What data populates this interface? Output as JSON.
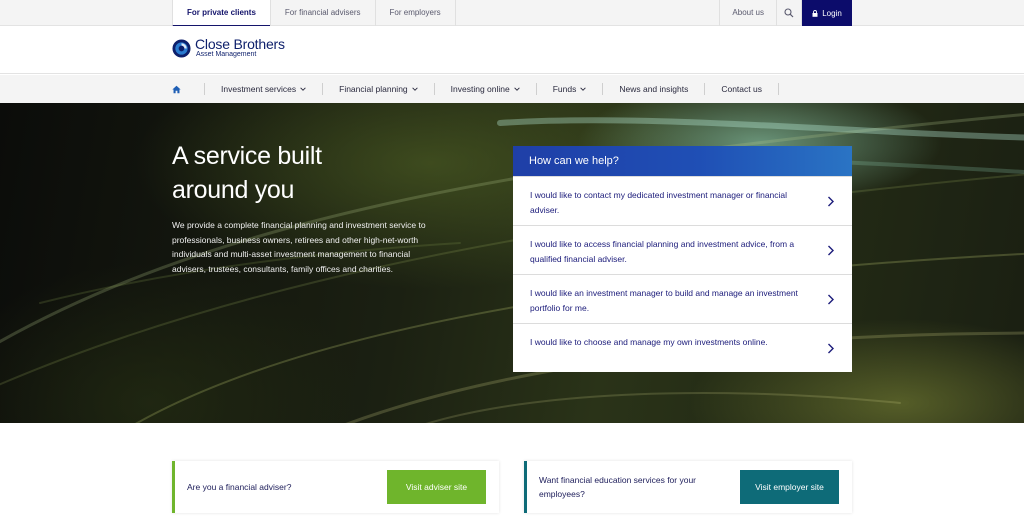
{
  "audience_tabs": [
    {
      "label": "For private clients",
      "active": true
    },
    {
      "label": "For financial advisers",
      "active": false
    },
    {
      "label": "For employers",
      "active": false
    }
  ],
  "topbar": {
    "about_label": "About us",
    "search_icon": "search-icon",
    "login_label": "Login",
    "login_icon": "lock-icon"
  },
  "logo": {
    "name": "Close Brothers",
    "subtitle": "Asset Management"
  },
  "nav": {
    "home_icon": "home-icon",
    "items": [
      {
        "label": "Investment services",
        "has_dropdown": true
      },
      {
        "label": "Financial planning",
        "has_dropdown": true
      },
      {
        "label": "Investing online",
        "has_dropdown": true
      },
      {
        "label": "Funds",
        "has_dropdown": true
      },
      {
        "label": "News and insights",
        "has_dropdown": false
      },
      {
        "label": "Contact us",
        "has_dropdown": false
      }
    ]
  },
  "hero": {
    "title_line1": "A service built",
    "title_line2": "around you",
    "body": "We provide a complete financial planning and investment service to professionals, business owners, retirees and other high-net-worth individuals and multi-asset investment management to financial advisers, trustees, consultants, family offices and charities."
  },
  "help": {
    "heading": "How can we help?",
    "items": [
      "I would like to contact my dedicated investment manager or financial adviser.",
      "I would like to access financial planning and investment advice, from a qualified financial adviser.",
      "I would like an investment manager to build and manage an investment portfolio for me.",
      "I would like to choose and manage my own investments online."
    ]
  },
  "cards": {
    "adviser": {
      "text": "Are you a financial adviser?",
      "button": "Visit adviser site"
    },
    "employer": {
      "text": "Want financial education services for your employees?",
      "button": "Visit employer site"
    }
  },
  "colors": {
    "brand_navy": "#0c0c6b",
    "help_header": "#1f4fb5",
    "adviser_green": "#6fb52c",
    "employer_teal": "#0e6b78"
  }
}
